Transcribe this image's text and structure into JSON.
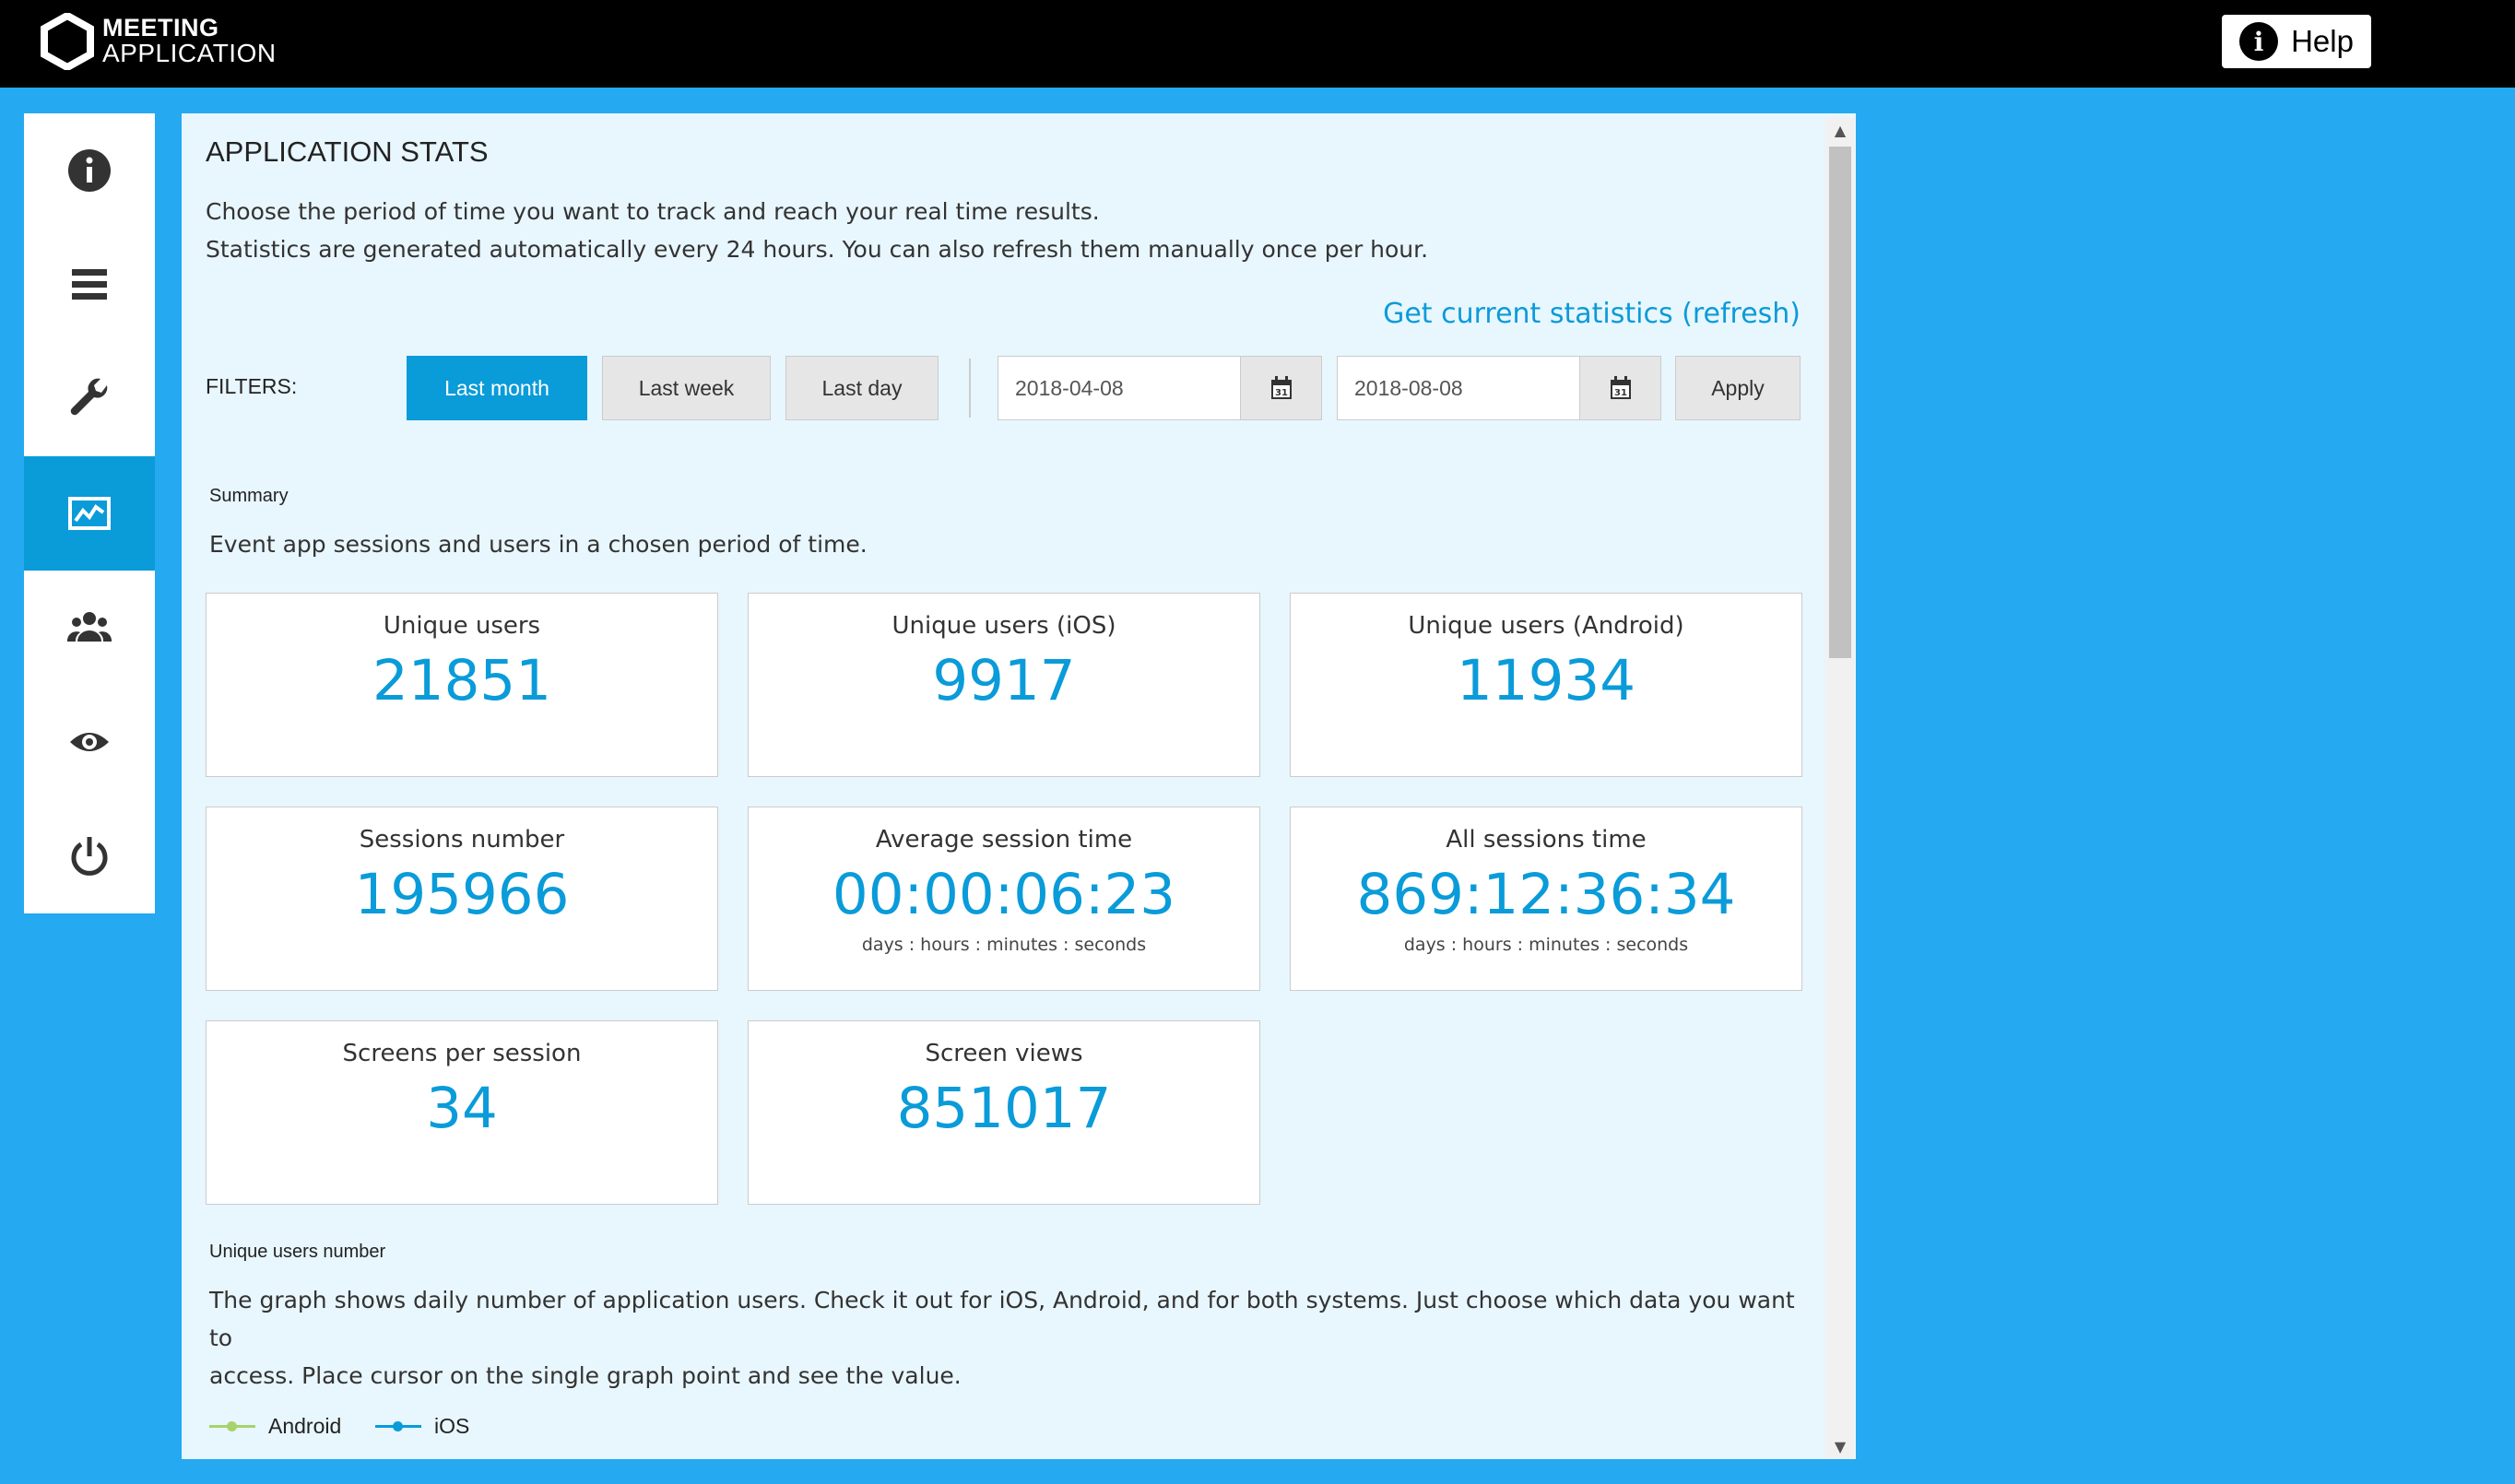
{
  "header": {
    "logo_line1": "MEETING",
    "logo_line2": "APPLICATION",
    "help_label": "Help"
  },
  "sidebar": {
    "items": [
      {
        "icon": "info-icon",
        "active": false
      },
      {
        "icon": "menu-icon",
        "active": false
      },
      {
        "icon": "wrench-icon",
        "active": false
      },
      {
        "icon": "stats-chart-icon",
        "active": true
      },
      {
        "icon": "users-icon",
        "active": false
      },
      {
        "icon": "eye-icon",
        "active": false
      },
      {
        "icon": "power-icon",
        "active": false
      }
    ]
  },
  "main": {
    "title": "APPLICATION STATS",
    "intro_line1": "Choose the period of time you want to track and reach your real time results.",
    "intro_line2": "Statistics are generated automatically every 24 hours. You can also refresh them manually once per hour.",
    "refresh_link": "Get current statistics (refresh)",
    "filters": {
      "label": "FILTERS:",
      "buttons": [
        "Last month",
        "Last week",
        "Last day"
      ],
      "active": "Last month",
      "date_from": "2018-04-08",
      "date_to": "2018-08-08",
      "apply_label": "Apply"
    },
    "summary": {
      "label": "Summary",
      "description": "Event app sessions and users in a chosen period of time.",
      "cards": [
        {
          "label": "Unique users",
          "value": "21851",
          "sub": ""
        },
        {
          "label": "Unique users (iOS)",
          "value": "9917",
          "sub": ""
        },
        {
          "label": "Unique users (Android)",
          "value": "11934",
          "sub": ""
        },
        {
          "label": "Sessions number",
          "value": "195966",
          "sub": ""
        },
        {
          "label": "Average session time",
          "value": "00:00:06:23",
          "sub": "days : hours : minutes : seconds"
        },
        {
          "label": "All sessions time",
          "value": "869:12:36:34",
          "sub": "days : hours : minutes : seconds"
        },
        {
          "label": "Screens per session",
          "value": "34",
          "sub": ""
        },
        {
          "label": "Screen views",
          "value": "851017",
          "sub": ""
        }
      ]
    },
    "unique_users_section": {
      "label": "Unique users number",
      "line1": "The graph shows daily number of application users. Check it out for iOS, Android, and for both systems. Just choose which data you want to",
      "line2": "access. Place cursor on the single graph point and see the value."
    },
    "legend": [
      {
        "name": "Android",
        "color": "#a8d26b"
      },
      {
        "name": "iOS",
        "color": "#0a9bd9"
      }
    ]
  },
  "colors": {
    "accent": "#0a9bd9",
    "background": "#25a9f1",
    "topbar": "#000000"
  }
}
